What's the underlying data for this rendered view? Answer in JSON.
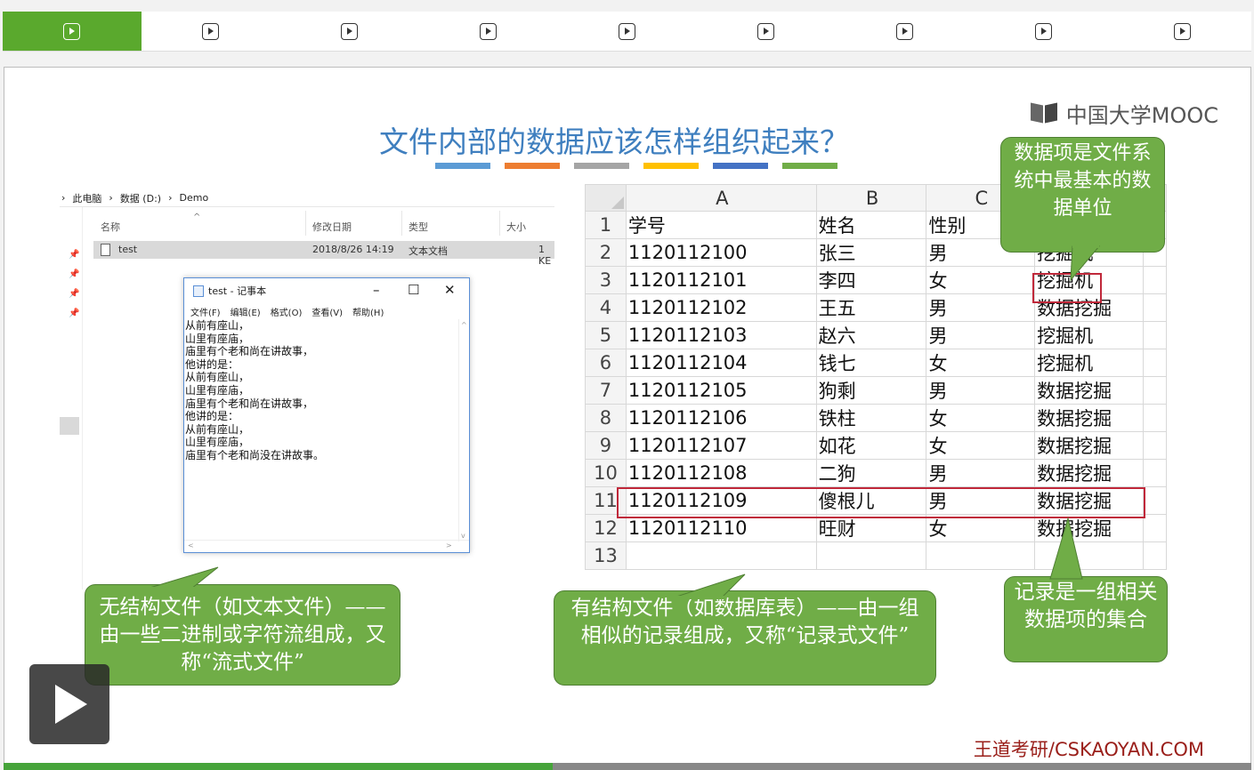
{
  "nav": {
    "segments": 9,
    "active_index": 0
  },
  "slide": {
    "title": "文件内部的数据应该怎样组织起来？",
    "title_bar_colors": [
      "#5b9bd5",
      "#ed7d31",
      "#a5a5a5",
      "#ffc000",
      "#4472c4",
      "#70ad47"
    ],
    "brand": "中国大学MOOC",
    "watermark": "王道考研/CSKAOYAN.COM"
  },
  "explorer": {
    "breadcrumb": [
      "此电脑",
      "数据 (D:)",
      "Demo"
    ],
    "columns": [
      "名称",
      "修改日期",
      "类型",
      "大小"
    ],
    "file": {
      "name": "test",
      "modified": "2018/8/26 14:19",
      "type": "文本文档",
      "size": "1 KE"
    }
  },
  "notepad": {
    "title": "test - 记事本",
    "menu": [
      "文件(F)",
      "编辑(E)",
      "格式(O)",
      "查看(V)",
      "帮助(H)"
    ],
    "content": "从前有座山，\n山里有座庙，\n庙里有个老和尚在讲故事，\n他讲的是：\n从前有座山，\n山里有座庙，\n庙里有个老和尚在讲故事，\n他讲的是：\n从前有座山，\n山里有座庙，\n庙里有个老和尚没在讲故事。"
  },
  "callouts": {
    "unstructured": "无结构文件（如文本文件）——由一些二进制或字符流组成，又称“流式文件”",
    "structured": "有结构文件（如数据库表）——由一组相似的记录组成，又称“记录式文件”",
    "data_item": "数据项是文件系统中最基本的数据单位",
    "record": "记录是一组相关数据项的集合"
  },
  "sheet": {
    "columns": [
      "A",
      "B",
      "C"
    ],
    "rows": [
      [
        "学号",
        "姓名",
        "性别",
        ""
      ],
      [
        "1120112100",
        "张三",
        "男",
        "挖掘机"
      ],
      [
        "1120112101",
        "李四",
        "女",
        "挖掘机"
      ],
      [
        "1120112102",
        "王五",
        "男",
        "数据挖掘"
      ],
      [
        "1120112103",
        "赵六",
        "男",
        "挖掘机"
      ],
      [
        "1120112104",
        "钱七",
        "女",
        "挖掘机"
      ],
      [
        "1120112105",
        "狗剩",
        "男",
        "数据挖掘"
      ],
      [
        "1120112106",
        "铁柱",
        "女",
        "数据挖掘"
      ],
      [
        "1120112107",
        "如花",
        "女",
        "数据挖掘"
      ],
      [
        "1120112108",
        "二狗",
        "男",
        "数据挖掘"
      ],
      [
        "1120112109",
        "傻根儿",
        "男",
        "数据挖掘"
      ],
      [
        "1120112110",
        "旺财",
        "女",
        "数据挖掘"
      ],
      [
        "",
        "",
        "",
        ""
      ]
    ],
    "row_numbers": [
      "1",
      "2",
      "3",
      "4",
      "5",
      "6",
      "7",
      "8",
      "9",
      "10",
      "11",
      "12",
      "13"
    ]
  },
  "player": {
    "progress": 0.44
  }
}
